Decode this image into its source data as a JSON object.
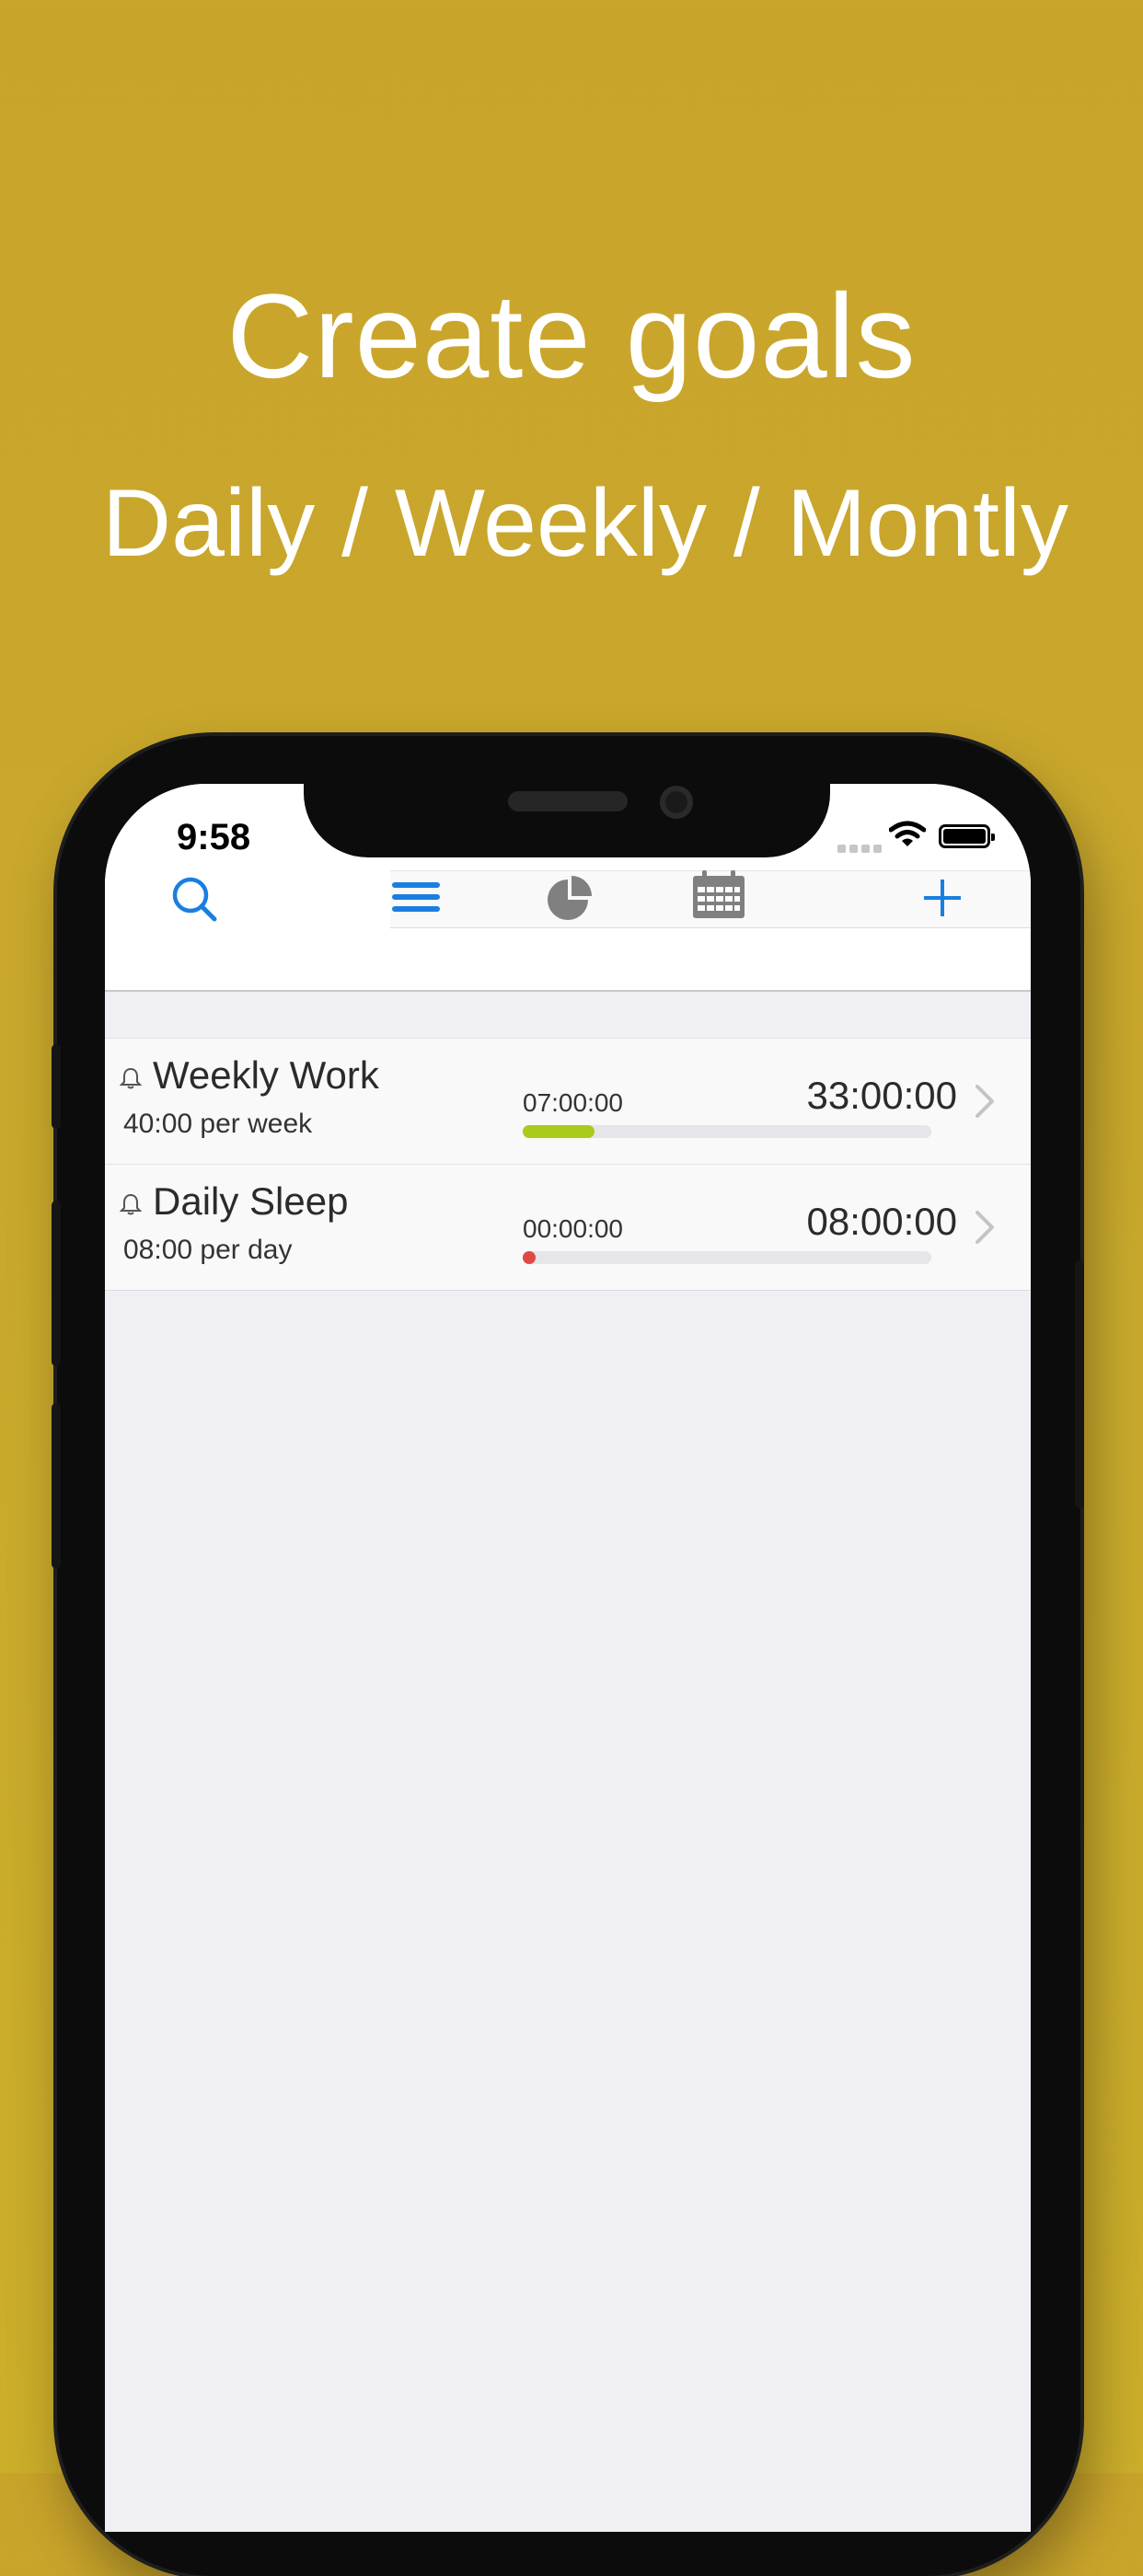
{
  "promo": {
    "headline": "Create goals",
    "subheadline": "Daily / Weekly / Montly"
  },
  "status_bar": {
    "time": "9:58",
    "battery_level": 1.0
  },
  "toolbar": {
    "icons": [
      "search-icon",
      "list-icon",
      "pie-chart-icon",
      "calendar-icon",
      "add-icon"
    ],
    "accent_color": "#1a7ee0",
    "inactive_color": "#808080"
  },
  "goals": [
    {
      "name": "Weekly Work",
      "target": "40:00 per week",
      "elapsed": "07:00:00",
      "remaining": "33:00:00",
      "progress": 0.175,
      "progress_color": "#a8cb1c",
      "has_reminder": true
    },
    {
      "name": "Daily Sleep",
      "target": "08:00 per day",
      "elapsed": "00:00:00",
      "remaining": "08:00:00",
      "progress": 0.0,
      "progress_color": "#e04848",
      "has_reminder": true
    }
  ]
}
